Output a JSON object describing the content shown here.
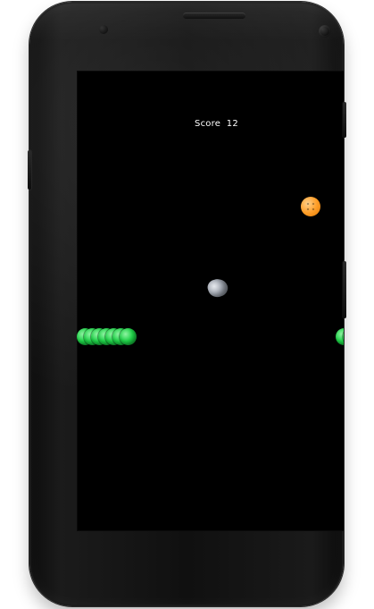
{
  "game": {
    "score_text": "Score  12"
  },
  "sprites": {
    "snake_color": "#1fd248",
    "food_color": "#ff9f2a",
    "rock_color": "#a2a8b2"
  }
}
